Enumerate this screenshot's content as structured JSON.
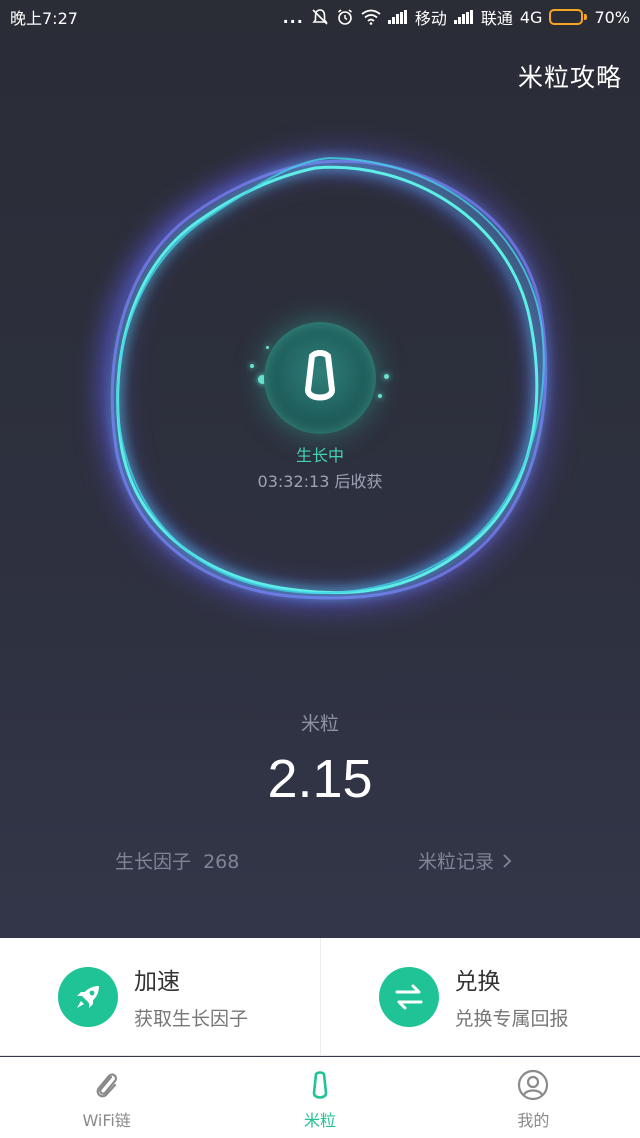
{
  "status_bar": {
    "time": "晚上7:27",
    "dots": "...",
    "carrier1": "移动",
    "carrier2": "联通",
    "network": "4G",
    "battery": "70%",
    "battery_level": 0.7,
    "battery_color": "#f5a623"
  },
  "header": {
    "guide_link": "米粒攻略"
  },
  "growth": {
    "status": "生长中",
    "timer": "03:32:13 后收获"
  },
  "points": {
    "label": "米粒",
    "value": "2.15",
    "factor_label": "生长因子",
    "factor_value": "268",
    "record_link": "米粒记录"
  },
  "actions": [
    {
      "title": "加速",
      "subtitle": "获取生长因子",
      "icon": "rocket-icon"
    },
    {
      "title": "兑换",
      "subtitle": "兑换专属回报",
      "icon": "exchange-arrows-icon"
    }
  ],
  "tabs": [
    {
      "label": "WiFi链",
      "icon": "paperclip-icon",
      "active": false
    },
    {
      "label": "米粒",
      "icon": "rice-grain-icon",
      "active": true
    },
    {
      "label": "我的",
      "icon": "user-icon",
      "active": false
    }
  ],
  "colors": {
    "accent": "#1fc395",
    "ring_cyan": "#5ef0e6",
    "ring_violet": "#7b6cf0"
  }
}
